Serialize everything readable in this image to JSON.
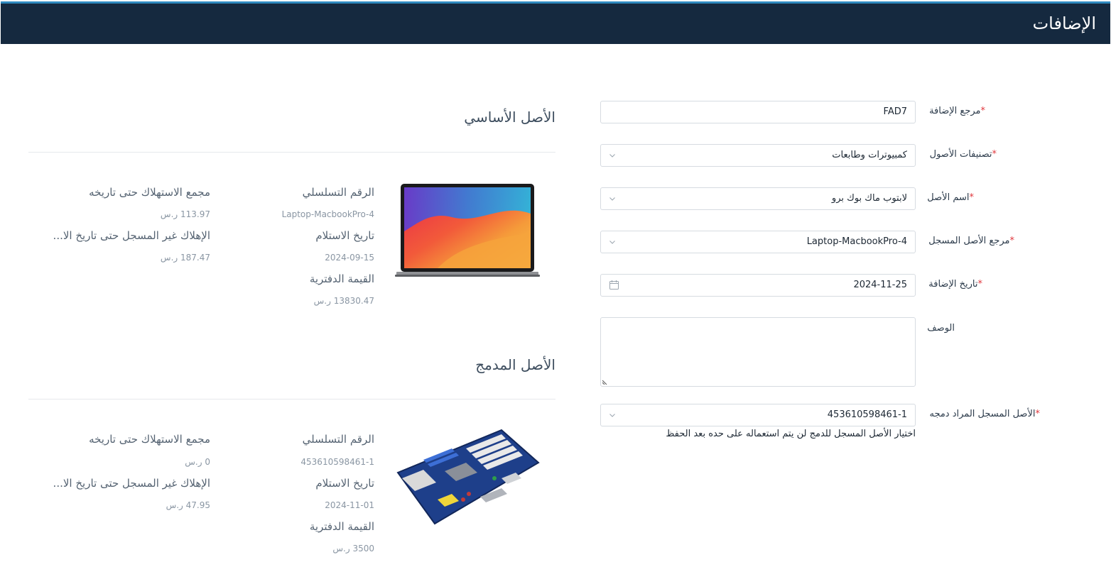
{
  "page": {
    "title": "الإضافات"
  },
  "form": {
    "addition_ref": {
      "label": "مرجع الإضافة",
      "value": "FAD7"
    },
    "asset_categories": {
      "label": "تصنيفات الأصول",
      "value": "كمبيوترات وطابعات"
    },
    "asset_name": {
      "label": "اسم الأصل",
      "value": "لابتوب ماك بوك برو"
    },
    "registered_asset_ref": {
      "label": "مرجع الأصل المسجل",
      "value": "Laptop-MacbookPro-4"
    },
    "addition_date": {
      "label": "تاريخ الإضافة",
      "value": "2024-11-25"
    },
    "description": {
      "label": "الوصف",
      "value": ""
    },
    "merge_asset": {
      "label": "الأصل المسجل المراد دمجه",
      "value": "453610598461-1"
    },
    "merge_hint": "اختيار الأصل المسجل للدمج لن يتم استعماله على حده بعد الحفظ",
    "required_mark": "*"
  },
  "base_asset": {
    "title": "الأصل الأساسي",
    "serial_label": "الرقم التسلسلي",
    "serial_value": "Laptop-MacbookPro-4",
    "receive_label": "تاريخ الاستلام",
    "receive_value": "2024-09-15",
    "book_label": "القيمة الدفترية",
    "book_value": "13830.47 ر.س",
    "dep_label": "مجمع الاستهلاك حتى تاريخه",
    "dep_value": "113.97 ر.س",
    "unreg_label": "الإهلاك غير المسجل حتى تاريخ الا...",
    "unreg_value": "187.47 ر.س"
  },
  "merged_asset": {
    "title": "الأصل المدمج",
    "serial_label": "الرقم التسلسلي",
    "serial_value": "453610598461-1",
    "receive_label": "تاريخ الاستلام",
    "receive_value": "2024-11-01",
    "book_label": "القيمة الدفترية",
    "book_value": "3500 ر.س",
    "dep_label": "مجمع الاستهلاك حتى تاريخه",
    "dep_value": "0 ر.س",
    "unreg_label": "الإهلاك غير المسجل حتى تاريخ الا...",
    "unreg_value": "47.95 ر.س"
  },
  "icons": {
    "dropdown": "chevron-down-icon",
    "calendar": "calendar-icon",
    "laptop": "laptop-image",
    "motherboard": "motherboard-image"
  },
  "colors": {
    "header_bg": "#15293f",
    "header_accent": "#2f8ac0",
    "required": "#e0363c"
  }
}
